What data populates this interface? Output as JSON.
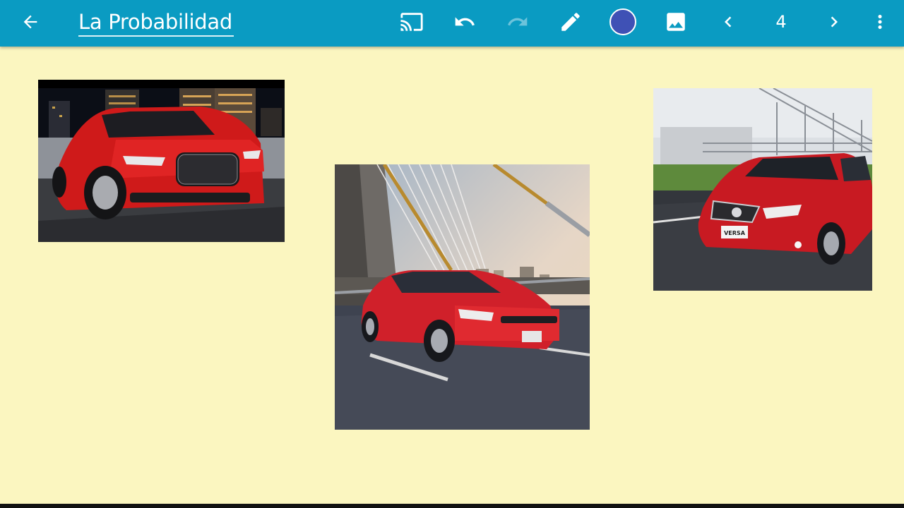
{
  "toolbar": {
    "back_icon": "arrow-back-icon",
    "title": "La Probabilidad",
    "cast_icon": "cast-icon",
    "undo_icon": "undo-icon",
    "redo_icon": "redo-icon",
    "pen_icon": "pen-icon",
    "pen_color": "#3F51B5",
    "image_icon": "insert-image-icon",
    "prev_icon": "chevron-left-icon",
    "page_number": "4",
    "next_icon": "chevron-right-icon",
    "more_icon": "more-vert-icon"
  },
  "canvas": {
    "background": "#FBF6C0",
    "images": [
      {
        "name": "red-chrysler-300-photo",
        "car_color": "#D01818"
      },
      {
        "name": "red-volkswagen-virtus-photo",
        "car_color": "#D0202A"
      },
      {
        "name": "red-nissan-versa-photo",
        "car_color": "#C81A22",
        "plate_text": "VERSA"
      }
    ]
  },
  "colors": {
    "toolbar": "#0A9BC2",
    "redo_disabled": "#6CC3DB"
  }
}
